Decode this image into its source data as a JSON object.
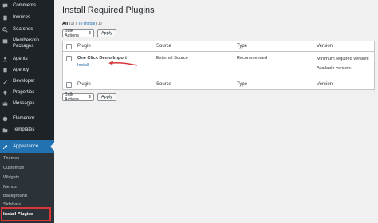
{
  "sidebar": {
    "items": [
      {
        "label": "Comments",
        "icon": "comment-icon"
      },
      {
        "label": "Invoices",
        "icon": "document-icon"
      },
      {
        "label": "Searches",
        "icon": "search-icon"
      },
      {
        "label": "Membership Packages",
        "icon": "package-icon"
      },
      {
        "label": "Agents",
        "icon": "users-icon"
      },
      {
        "label": "Agency",
        "icon": "building-icon"
      },
      {
        "label": "Developer",
        "icon": "tools-icon"
      },
      {
        "label": "Properties",
        "icon": "location-icon"
      },
      {
        "label": "Messages",
        "icon": "mail-icon"
      },
      {
        "label": "Elementor",
        "icon": "elementor-icon"
      },
      {
        "label": "Templates",
        "icon": "folder-icon"
      }
    ],
    "active": {
      "label": "Appearance",
      "icon": "paintbrush-icon"
    },
    "submenu": [
      "Themes",
      "Customize",
      "Widgets",
      "Menus",
      "Background",
      "Sidebars",
      "Install Plugins"
    ]
  },
  "page": {
    "title": "Install Required Plugins",
    "filters": {
      "all": "All",
      "all_count": "(1)",
      "separator": "|",
      "to_install": "To Install",
      "to_install_count": "(1)"
    },
    "bulk_actions": "Bulk Actions",
    "apply": "Apply"
  },
  "table": {
    "columns": [
      "Plugin",
      "Source",
      "Type",
      "Version"
    ],
    "rows": [
      {
        "plugin": "One Click Demo Import",
        "action": "Install",
        "source": "External Source",
        "type": "Recommended",
        "version_min": "Minimum required version:",
        "version_avail": "Available version:"
      }
    ]
  },
  "colors": {
    "accent": "#2271b1",
    "sidebar": "#1d2327",
    "highlight": "#d63638",
    "arrow": "#d63638"
  }
}
